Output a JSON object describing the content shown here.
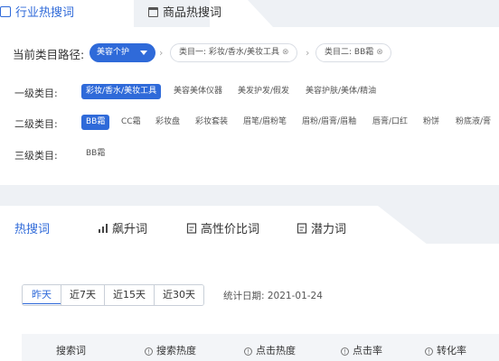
{
  "top_tabs": [
    {
      "label": "行业热搜词"
    },
    {
      "label": "商品热搜词"
    }
  ],
  "path": {
    "label": "当前类目路径:",
    "selected": "美容个护",
    "crumbs": [
      {
        "label": "类目一: 彩妆/香水/美妆工具"
      },
      {
        "label": "类目二: BB霜"
      }
    ]
  },
  "levels": [
    {
      "label": "一级类目:",
      "items": [
        "彩妆/香水/美妆工具",
        "美容美体仪器",
        "美发护发/假发",
        "美容护肤/美体/精油"
      ]
    },
    {
      "label": "二级类目:",
      "items": [
        "BB霜",
        "CC霜",
        "彩妆盘",
        "彩妆套装",
        "眉笔/眉粉笔",
        "眉粉/眉膏/眉釉",
        "唇膏/口红",
        "粉饼",
        "粉底液/膏"
      ]
    },
    {
      "label": "三级类目:",
      "items": [
        "BB霜"
      ]
    }
  ],
  "hot_tabs": [
    {
      "label": "热搜词",
      "icon": "none"
    },
    {
      "label": "飙升词",
      "icon": "bar-chart-icon"
    },
    {
      "label": "高性价比词",
      "icon": "document-icon"
    },
    {
      "label": "潜力词",
      "icon": "document-icon"
    }
  ],
  "ranges": [
    "昨天",
    "近7天",
    "近15天",
    "近30天"
  ],
  "stat_date": "统计日期: 2021-01-24",
  "table_headers": [
    "搜索词",
    "搜索热度",
    "点击热度",
    "点击率",
    "转化率"
  ],
  "accent": "#2f6ad9"
}
